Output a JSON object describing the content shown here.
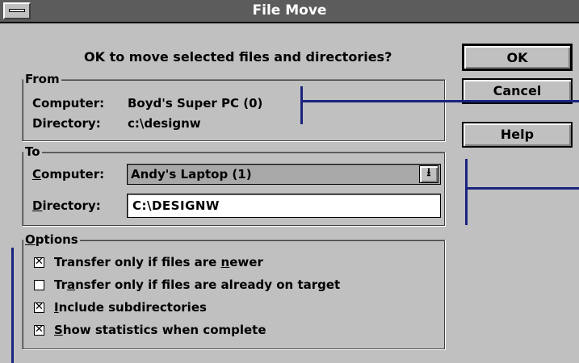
{
  "window": {
    "title": "File Move"
  },
  "prompt": "OK to move selected files and directories?",
  "from": {
    "label": "From",
    "computer_label": "Computer:",
    "computer_value": "Boyd's Super PC (0)",
    "directory_label": "Directory:",
    "directory_value": "c:\\designw"
  },
  "to": {
    "label": "To",
    "computer_label_key": "C",
    "computer_label_rest": "omputer:",
    "computer_value": "Andy's Laptop (1)",
    "directory_label_key": "D",
    "directory_label_rest": "irectory:",
    "directory_value": "C:\\DESIGNW"
  },
  "options": {
    "label_key": "O",
    "label_rest": "ptions",
    "items": [
      {
        "pre": "Transfer only if files are ",
        "key": "n",
        "post": "ewer",
        "checked": true
      },
      {
        "pre": "Tr",
        "key": "a",
        "post": "nsfer only if files are already on target",
        "checked": false
      },
      {
        "pre": "",
        "key": "I",
        "post": "nclude subdirectories",
        "checked": true
      },
      {
        "pre": "",
        "key": "S",
        "post": "how statistics when complete",
        "checked": true
      }
    ],
    "check_mark": "✕"
  },
  "buttons": {
    "ok": "OK",
    "cancel": "Cancel",
    "help": "Help"
  },
  "dropdown_arrow": "⭳",
  "colors": {
    "titlebar": "#5c5c5c",
    "face": "#c0c0c0",
    "annotation_line": "#1a237e"
  }
}
